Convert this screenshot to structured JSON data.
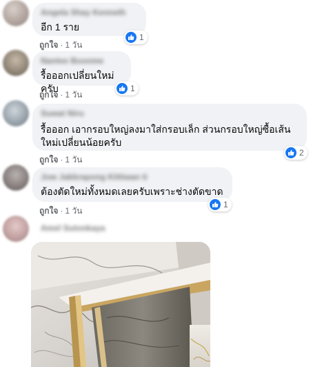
{
  "comments": [
    {
      "author": "Angela Shay Kenneth",
      "text": "อีก 1 ราย",
      "reaction_count": "1",
      "like_label": "ถูกใจ",
      "time": "1 วัน"
    },
    {
      "author": "Nantee Boonme",
      "text": "รื้อออกเปลี่ยนใหม่ครับ",
      "reaction_count": "1",
      "like_label": "ถูกใจ",
      "time": "1 วัน"
    },
    {
      "author": "Suwat Niru",
      "text": "รื้อออก เอากรอบใหญ่ลงมาใส่กรอบเล็ก ส่วนกรอบใหญ่ซื้อเส้น\nใหม่เปลี่ยนน้อยครับ",
      "reaction_count": "2",
      "like_label": "ถูกใจ",
      "time": "1 วัน"
    },
    {
      "author": "Jow Jakkrapong Kittiwan ti",
      "text": "ต้องตัดใหม่ทั้งหมดเลยครับเพราะช่างตัดขาด",
      "reaction_count": "1",
      "like_label": "ถูกใจ",
      "time": "1 วัน"
    },
    {
      "author": "Amel Sutonkaya"
    }
  ],
  "icons": {
    "like": "thumbs-up-icon"
  },
  "colors": {
    "bubble": "#f0f2f5",
    "like_blue": "#1877f2",
    "meta_gray": "#65676b"
  }
}
